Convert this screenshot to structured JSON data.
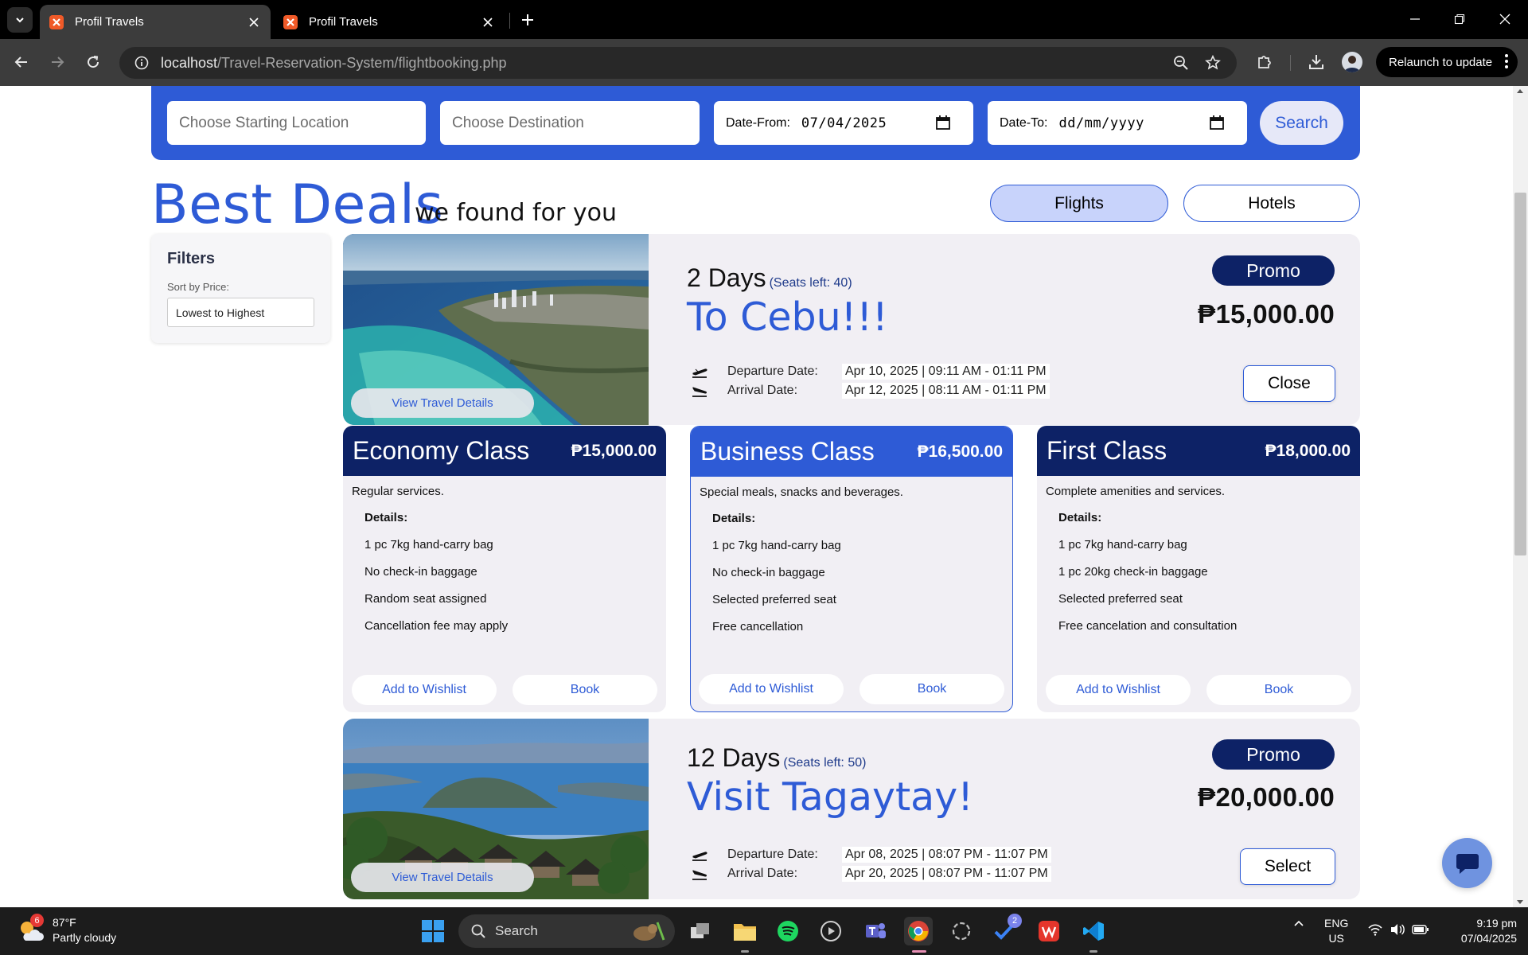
{
  "browser": {
    "tabs": [
      {
        "title": "Profil Travels",
        "active": true
      },
      {
        "title": "Profil Travels",
        "active": false
      }
    ],
    "url_host": "localhost",
    "url_path": "/Travel-Reservation-System/flightbooking.php",
    "relaunch_label": "Relaunch to update"
  },
  "search": {
    "start_placeholder": "Choose Starting Location",
    "dest_placeholder": "Choose Destination",
    "date_from_label": "Date-From:",
    "date_from_value": "07/04/2025",
    "date_to_label": "Date-To:",
    "date_to_value": "dd/mm/yyyy",
    "button": "Search"
  },
  "heading": {
    "title": "Best Deals",
    "subtitle": "we found for you"
  },
  "mode_tabs": {
    "flights": "Flights",
    "hotels": "Hotels",
    "active": "Flights"
  },
  "filters": {
    "title": "Filters",
    "sort_label": "Sort by Price:",
    "sort_value": "Lowest to Highest"
  },
  "deals": [
    {
      "days": "2 Days",
      "seats": "(Seats left: 40)",
      "destination": "To Cebu!!!",
      "badge": "Promo",
      "price": "₱15,000.00",
      "departure_label": "Departure Date:",
      "departure_value": "Apr 10, 2025 | 09:11 AM - 01:11 PM",
      "arrival_label": "Arrival Date:",
      "arrival_value": "Apr 12, 2025 | 08:11 AM - 01:11 PM",
      "action": "Close",
      "view_details": "View Travel Details"
    },
    {
      "days": "12 Days",
      "seats": "(Seats left: 50)",
      "destination": "Visit Tagaytay!",
      "badge": "Promo",
      "price": "₱20,000.00",
      "departure_label": "Departure Date:",
      "departure_value": "Apr 08, 2025 | 08:07 PM - 11:07 PM",
      "arrival_label": "Arrival Date:",
      "arrival_value": "Apr 20, 2025 | 08:07 PM - 11:07 PM",
      "action": "Select",
      "view_details": "View Travel Details"
    }
  ],
  "fares": [
    {
      "name": "Economy Class",
      "price": "₱15,000.00",
      "description": "Regular services.",
      "details_label": "Details:",
      "items": [
        "1 pc 7kg hand-carry bag",
        "No check-in baggage",
        "Random seat assigned",
        "Cancellation fee may apply"
      ],
      "wishlist": "Add to Wishlist",
      "book": "Book",
      "header_color": "#0d2266",
      "selected": false
    },
    {
      "name": "Business Class",
      "price": "₱16,500.00",
      "description": "Special meals, snacks and beverages.",
      "details_label": "Details:",
      "items": [
        "1 pc 7kg hand-carry bag",
        "No check-in baggage",
        "Selected preferred seat",
        "Free cancellation"
      ],
      "wishlist": "Add to Wishlist",
      "book": "Book",
      "header_color": "#2e5bd6",
      "selected": true
    },
    {
      "name": "First Class",
      "price": "₱18,000.00",
      "description": "Complete amenities and services.",
      "details_label": "Details:",
      "items": [
        "1 pc 7kg hand-carry bag",
        "1 pc 20kg check-in baggage",
        "Selected preferred seat",
        "Free cancelation and consultation"
      ],
      "wishlist": "Add to Wishlist",
      "book": "Book",
      "header_color": "#0d2266",
      "selected": false
    }
  ],
  "colors": {
    "accent": "#2e5bd6",
    "navy": "#0d2266",
    "card_bg": "#f1eff4"
  },
  "taskbar": {
    "weather_temp": "87°F",
    "weather_desc": "Partly cloudy",
    "weather_badge": "6",
    "search_label": "Search",
    "todo_badge": "2",
    "lang_1": "ENG",
    "lang_2": "US",
    "time": "9:19 pm",
    "date": "07/04/2025"
  }
}
